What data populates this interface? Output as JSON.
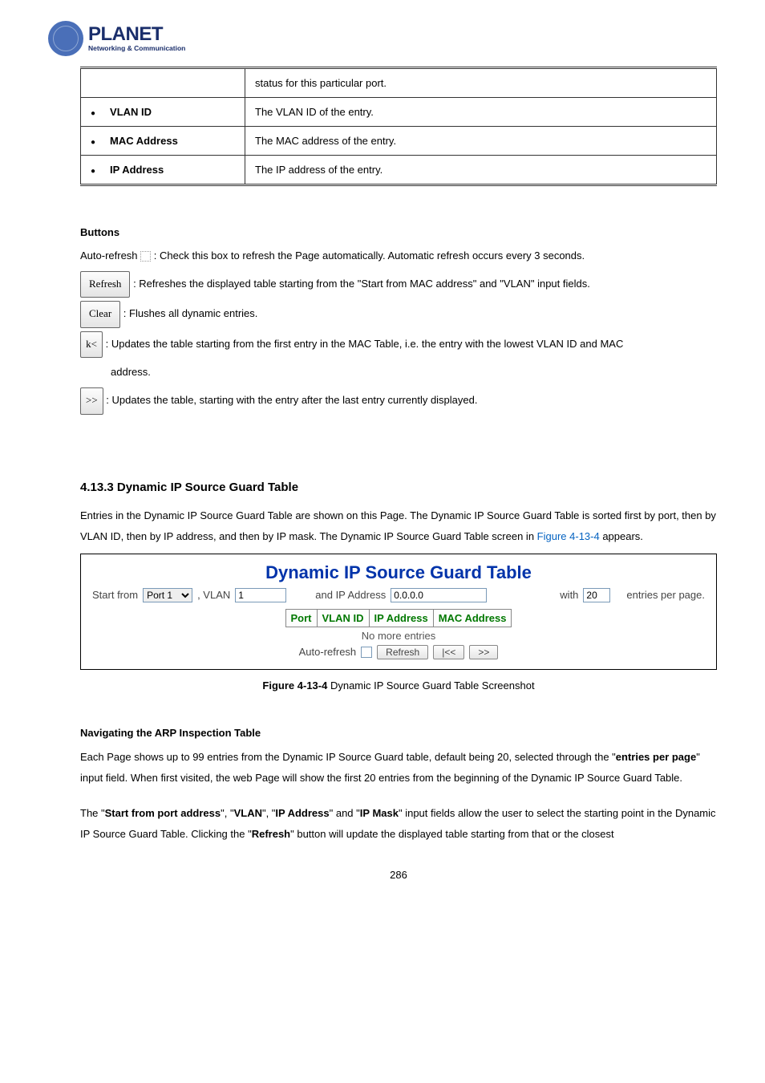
{
  "logo": {
    "brand": "PLANET",
    "tagline": "Networking & Communication"
  },
  "def_table": {
    "rows": [
      {
        "label": "",
        "desc": "status for this particular port.",
        "show_bullet": false,
        "bold": ""
      },
      {
        "label": "VLAN ID",
        "desc": "The VLAN ID of the entry.",
        "show_bullet": true,
        "bold": ""
      },
      {
        "label": "MAC Address",
        "desc": "The MAC address of the entry.",
        "show_bullet": true,
        "bold": ""
      },
      {
        "label": "IP Address",
        "desc": "The IP address of the entry.",
        "show_bullet": true,
        "bold": ""
      }
    ]
  },
  "buttons_section": {
    "heading": "Buttons",
    "auto_refresh": {
      "label": "Auto-refresh ",
      "desc": ": Check this box to refresh the Page automatically. Automatic refresh occurs every 3 seconds."
    },
    "refresh": {
      "label": "Refresh",
      "desc": ": Refreshes the displayed table starting from the \"Start from MAC address\" and \"VLAN\" input fields."
    },
    "clear": {
      "label": "Clear",
      "desc": ": Flushes all dynamic entries."
    },
    "first": {
      "label": "k<",
      "desc": ": Updates the table starting from the first entry in the MAC Table, i.e. the entry with the lowest VLAN ID and MAC",
      "desc2": "address."
    },
    "next": {
      "label": ">>",
      "desc": ": Updates the table, starting with the entry after the last entry currently displayed."
    }
  },
  "subsection": {
    "number": "4.13.3 Dynamic IP Source Guard Table",
    "para_a": "Entries in the Dynamic IP Source Guard Table are shown on this Page. The Dynamic IP Source Guard Table is sorted first by port, then by VLAN ID, then by IP address, and then by IP mask. The Dynamic IP Source Guard Table screen in ",
    "fig_link": "Figure 4-13-4",
    "para_b": " appears."
  },
  "screenshot": {
    "title": "Dynamic IP Source Guard Table",
    "start_from": "Start from",
    "port_value": "Port 1",
    "vlan_label": ", VLAN",
    "vlan_value": "1",
    "ip_label": "and IP Address",
    "ip_value": "0.0.0.0",
    "with_label": "with",
    "count_value": "20",
    "per_page": "entries per page.",
    "th": [
      "Port",
      "VLAN ID",
      "IP Address",
      "MAC Address"
    ],
    "no_more": "No more entries",
    "auto_refresh": "Auto-refresh",
    "btn_refresh": "Refresh",
    "btn_first": "|<<",
    "btn_next": ">>"
  },
  "figure": {
    "label_prefix": "Figure 4-13-4 ",
    "label": "Dynamic IP Source Guard Table Screenshot"
  },
  "nav": {
    "heading": "Navigating the ARP Inspection Table",
    "p1a": "Each Page shows up to 99 entries from the Dynamic IP Source Guard table, default being 20, selected through the \"",
    "p1b": "entries per page",
    "p1c": "\" input field. When first visited, the web Page will show the first 20 entries from the beginning of the Dynamic IP Source Guard Table.",
    "p2a": "The \"",
    "p2b": "Start from port address",
    "p2c": "\", \"",
    "p2d": "VLAN",
    "p2e": "\", \"",
    "p2f": "IP Address",
    "p2g": "\" and \"",
    "p2h": "IP Mask",
    "p2i": "\" input fields allow the user to select the starting point in the Dynamic IP Source Guard Table. Clicking the \"",
    "p2j": "Refresh",
    "p2k": "\" button will update the displayed table starting from that or the closest"
  },
  "page_number": "286"
}
